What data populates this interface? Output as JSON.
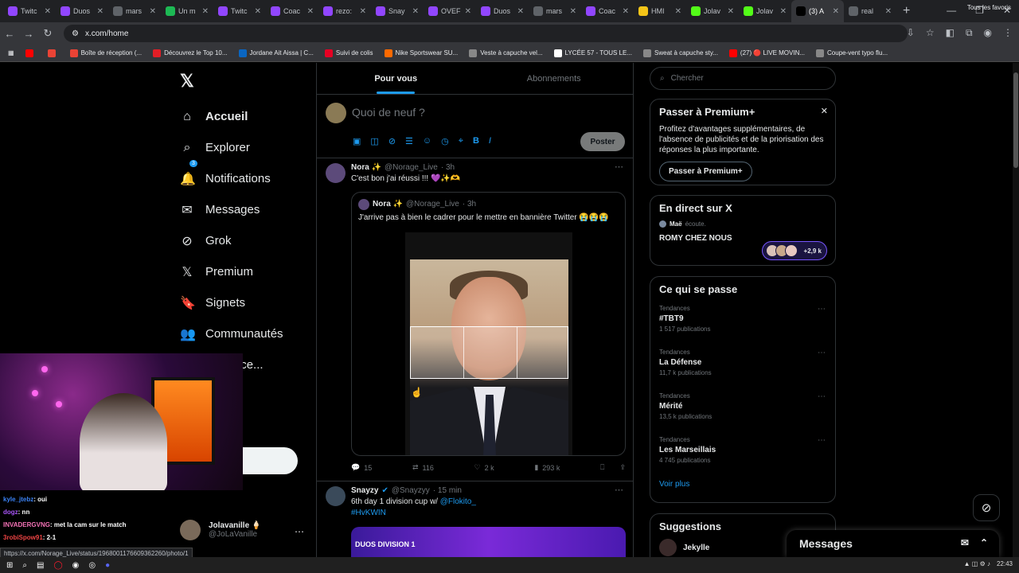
{
  "browser": {
    "tabs": [
      {
        "label": "Twitc",
        "color": "#9146ff"
      },
      {
        "label": "Duos",
        "color": "#9146ff"
      },
      {
        "label": "mars",
        "color": "#5f6368"
      },
      {
        "label": "Un m",
        "color": "#1db954"
      },
      {
        "label": "Twitc",
        "color": "#9146ff"
      },
      {
        "label": "Coac",
        "color": "#9146ff"
      },
      {
        "label": "rezo:",
        "color": "#9146ff"
      },
      {
        "label": "Snay",
        "color": "#9146ff"
      },
      {
        "label": "OVEF",
        "color": "#9146ff"
      },
      {
        "label": "Duos",
        "color": "#9146ff"
      },
      {
        "label": "mars",
        "color": "#5f6368"
      },
      {
        "label": "Coac",
        "color": "#9146ff"
      },
      {
        "label": "HMI",
        "color": "#f5c518"
      },
      {
        "label": "Jolav",
        "color": "#53fc18"
      },
      {
        "label": "Jolav",
        "color": "#53fc18"
      },
      {
        "label": "(3) A",
        "color": "#000000",
        "active": true
      },
      {
        "label": "real",
        "color": "#5f6368"
      }
    ],
    "url": "x.com/home",
    "bookmarks": [
      {
        "label": "",
        "color": "#ff0000"
      },
      {
        "label": "",
        "color": "#ea4335"
      },
      {
        "label": "Boîte de réception (...",
        "color": "#ea4335"
      },
      {
        "label": "Découvrez le Top 10...",
        "color": "#e21e26"
      },
      {
        "label": "Jordane Ait Aissa | C...",
        "color": "#0a66c2"
      },
      {
        "label": "Suivi de colis",
        "color": "#e60023"
      },
      {
        "label": "Nike Sportswear SU...",
        "color": "#ff6a00"
      },
      {
        "label": "Veste à capuche vel...",
        "color": "#888888"
      },
      {
        "label": "LYCÉE 57 - TOUS LE...",
        "color": "#ffffff"
      },
      {
        "label": "Sweat à capuche sty...",
        "color": "#888888"
      },
      {
        "label": "(27) 🔴 LIVE MOVIN...",
        "color": "#ff0000"
      },
      {
        "label": "Coupe-vent typo flu...",
        "color": "#888888"
      }
    ],
    "bookmarks_all": "Tous les favoris"
  },
  "x_logo": "𝕏",
  "nav": [
    {
      "label": "Accueil",
      "icon": "home-icon",
      "glyph": "⌂",
      "bold": true
    },
    {
      "label": "Explorer",
      "icon": "search-icon",
      "glyph": "⌕"
    },
    {
      "label": "Notifications",
      "icon": "bell-icon",
      "glyph": "🔔",
      "badge": "3"
    },
    {
      "label": "Messages",
      "icon": "mail-icon",
      "glyph": "✉"
    },
    {
      "label": "Grok",
      "icon": "grok-icon",
      "glyph": "⊘"
    },
    {
      "label": "Premium",
      "icon": "x-premium-icon",
      "glyph": "𝕏"
    },
    {
      "label": "Signets",
      "icon": "bookmark-icon",
      "glyph": "🔖"
    },
    {
      "label": "Communautés",
      "icon": "communities-icon",
      "glyph": "👥"
    },
    {
      "label": "ations ce...",
      "icon": "more-icon",
      "glyph": "⋯"
    }
  ],
  "post_button": "er",
  "profile": {
    "name": "Jolavanille 🍦",
    "handle": "@JoLaVanille"
  },
  "feed": {
    "tabs": [
      "Pour vous",
      "Abonnements"
    ],
    "composer_placeholder": "Quoi de neuf ?",
    "poster": "Poster"
  },
  "tweet1": {
    "name": "Nora ✨",
    "handle": "@Norage_Live",
    "time": "· 3h",
    "text": "C'est bon j'ai réussi !!! 💜✨🫶",
    "quote": {
      "name": "Nora ✨",
      "handle": "@Norage_Live",
      "time": "· 3h",
      "text": "J'arrive pas à bien le cadrer pour le mettre en bannière Twitter 😭😭😭"
    },
    "replies": "15",
    "reposts": "116",
    "likes": "2 k",
    "views": "293 k"
  },
  "tweet2": {
    "name": "Snayzy",
    "handle": "@Snayzyy",
    "time": "· 15 min",
    "text": "6th day 1 division cup w/",
    "mention": "@Flokito_",
    "hashtag": "#HvKWIN",
    "banner": "DUOS DIVISION 1"
  },
  "right": {
    "search_placeholder": "Chercher",
    "premium": {
      "title": "Passer à Premium+",
      "text": "Profitez d'avantages supplémentaires, de l'absence de publicités et de la priorisation des réponses la plus importante.",
      "button": "Passer à Premium+"
    },
    "live": {
      "title": "En direct sur X",
      "host": "Maë",
      "host_status": "écoute.",
      "space": "ROMY CHEZ NOUS",
      "listeners": "+2,9 k"
    },
    "trends_title": "Ce qui se passe",
    "trends": [
      {
        "cat": "Tendances",
        "name": "#TBT9",
        "posts": "1 517 publications"
      },
      {
        "cat": "Tendances",
        "name": "La Défense",
        "posts": "11,7 k publications"
      },
      {
        "cat": "Tendances",
        "name": "Mérité",
        "posts": "13,5 k publications"
      },
      {
        "cat": "Tendances",
        "name": "Les Marseillais",
        "posts": "4 745 publications"
      }
    ],
    "see_more": "Voir plus",
    "suggestions": "Suggestions",
    "suggestion_user": "Jekylle"
  },
  "messages_drawer": "Messages",
  "chat": [
    {
      "user": "kyle_jtebz",
      "msg": ": oui",
      "color": "#3b82f6"
    },
    {
      "user": "dogz",
      "msg": ": nn",
      "color": "#a855f7"
    },
    {
      "user": "INVADERGVNG",
      "msg": ": met la cam sur le match",
      "color": "#f472b6"
    },
    {
      "user": "3robiSpow91",
      "msg": ": 2-1",
      "color": "#ef4444"
    }
  ],
  "status_url": "https://x.com/Norage_Live/status/1968001176609362260/photo/1",
  "clock": "22:43"
}
